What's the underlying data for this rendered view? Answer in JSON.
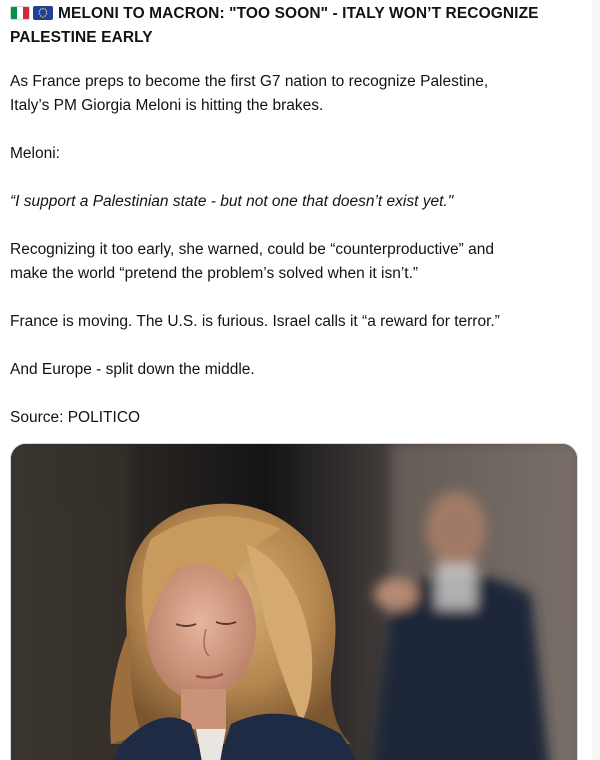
{
  "tweet": {
    "flags": [
      {
        "icon": "italy-flag-icon",
        "colors": [
          "#009246",
          "#ffffff",
          "#ce2b37"
        ]
      },
      {
        "icon": "eu-flag-icon",
        "colors": [
          "#1f3f9b",
          "#ffcc00"
        ]
      }
    ],
    "headline_line1": "MELONI TO MACRON: \"TOO SOON\" - ITALY WON’T RECOGNIZE",
    "headline_line2": "PALESTINE EARLY",
    "paragraphs": [
      {
        "line1": "As France preps to become the first G7 nation to recognize Palestine,",
        "line2": "Italy’s PM Giorgia Meloni is hitting the brakes."
      },
      {
        "line1": "Meloni:"
      },
      {
        "line1": "“I support a Palestinian state - but not one that doesn’t exist yet.\""
      },
      {
        "line1": "Recognizing it too early, she warned, could be “counterproductive” and",
        "line2": "make the world “pretend the problem’s solved when it isn’t.”"
      },
      {
        "line1": "France is moving. The U.S. is furious. Israel calls it “a reward for terror.”"
      },
      {
        "line1": "And Europe - split down the middle."
      },
      {
        "line1": "Source: POLITICO"
      }
    ],
    "media": {
      "icon": "photo-meloni-image"
    }
  }
}
